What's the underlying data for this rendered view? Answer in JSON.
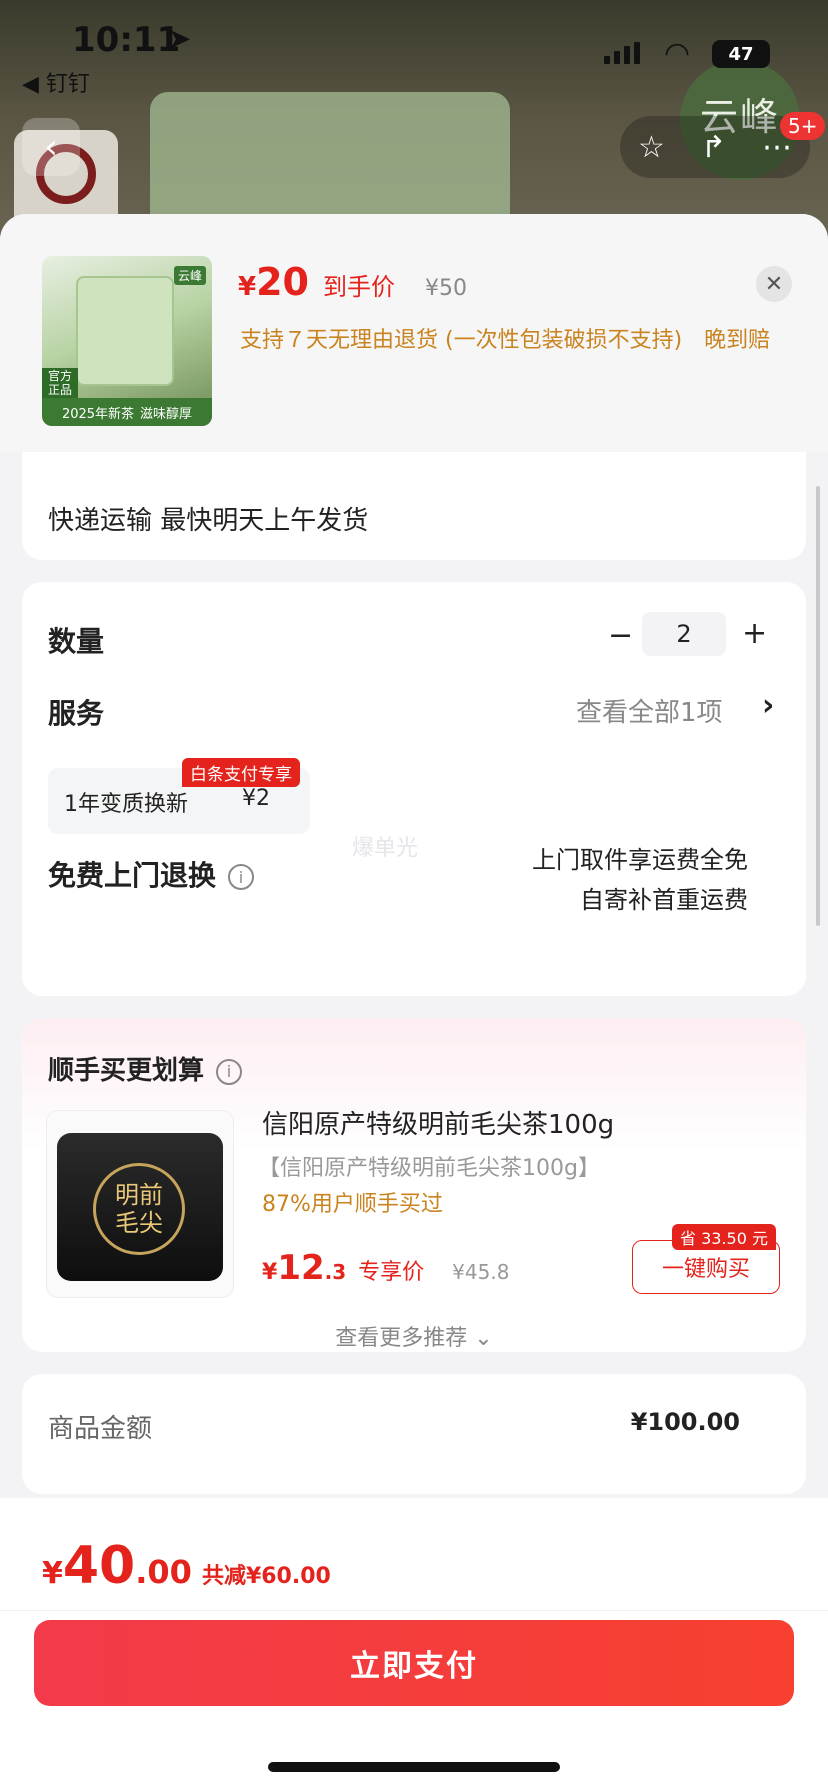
{
  "status_bar": {
    "time": "10:11",
    "back_app": "◀ 钉钉",
    "battery": "47"
  },
  "background": {
    "brand_mark": "云峰",
    "more_badge": "5+"
  },
  "product_header": {
    "price_symbol": "¥",
    "price": "20",
    "price_label": "到手价",
    "original_price": "¥50",
    "return_policy": "支持７天无理由退货 (一次性包装破损不支持)　晚到赔",
    "image_tags": {
      "official": "官方正品",
      "new": "2025年新茶",
      "taste": "滋味醇厚",
      "brand": "云峰"
    }
  },
  "shipping": {
    "text": "快递运输 最快明天上午发货"
  },
  "quantity": {
    "label": "数量",
    "value": "2"
  },
  "service": {
    "label": "服务",
    "link": "查看全部1项"
  },
  "service_option": {
    "name": "1年变质换新",
    "price": "¥2",
    "badge": "白条支付专享"
  },
  "free_return": {
    "label": "免费上门退换",
    "line1": "上门取件享运费全免",
    "line2": "自寄补首重运费",
    "watermark": "爆单光"
  },
  "recommend": {
    "title": "顺手买更划算",
    "item_name": "信阳原产特级明前毛尖茶100g",
    "item_sub": "【信阳原产特级明前毛尖茶100g】",
    "bought": "87%用户顺手买过",
    "price_symbol": "¥",
    "price_int": "12",
    "price_dec": ".3",
    "price_label": "专享价",
    "original_price": "¥45.8",
    "save_badge": "省 33.50 元",
    "buy_label": "一键购买",
    "seal_text": "明前\n毛尖",
    "more": "查看更多推荐"
  },
  "amount": {
    "label": "商品金额",
    "value": "¥100.00"
  },
  "checkout": {
    "symbol": "¥",
    "total_int": "40",
    "total_dec": ".00",
    "reduction": "共减¥60.00",
    "pay_label": "立即支付"
  },
  "colors": {
    "accent_red": "#e4231c",
    "orange_note": "#c9831f",
    "pay_button": "#f23a4a"
  }
}
